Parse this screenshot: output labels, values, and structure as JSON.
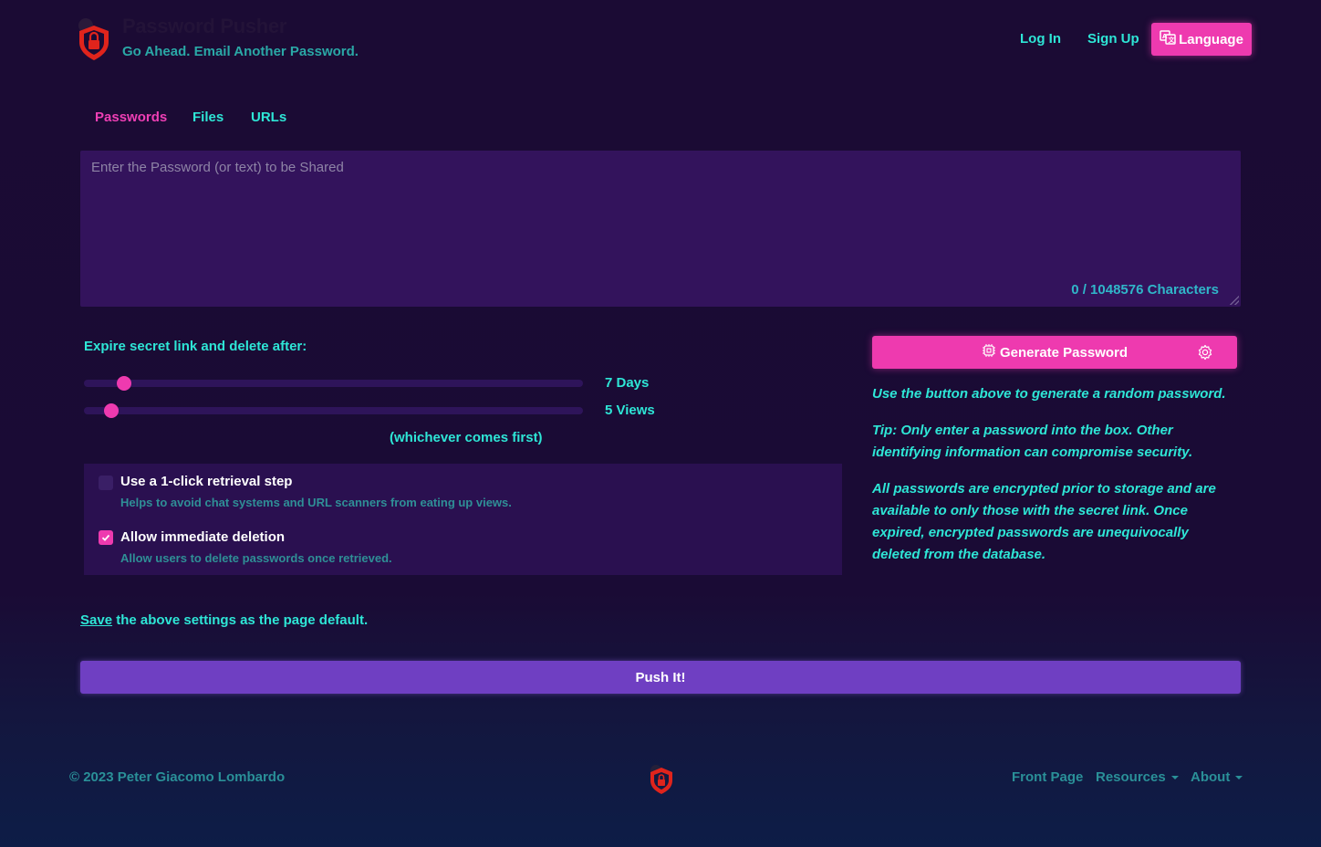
{
  "header": {
    "brand_title": "Password Pusher",
    "tagline": "Go Ahead. Email Another Password.",
    "login": "Log In",
    "signup": "Sign Up",
    "language": "Language",
    "logo_icon": "shield-lock-icon"
  },
  "tabs": [
    {
      "label": "Passwords",
      "active": true
    },
    {
      "label": "Files"
    },
    {
      "label": "URLs"
    }
  ],
  "editor": {
    "placeholder": "Enter the Password (or text) to be Shared",
    "value": "",
    "char_count": "0 / 1048576 Characters"
  },
  "expire": {
    "label": "Expire secret link and delete after:",
    "days_value": "7 Days",
    "views_value": "5 Views",
    "days_fraction": 0.08,
    "views_fraction": 0.054,
    "whichever": "(whichever comes first)"
  },
  "options": [
    {
      "title": "Use a 1-click retrieval step",
      "help": "Helps to avoid chat systems and URL scanners from eating up views.",
      "checked": false
    },
    {
      "title": "Allow immediate deletion",
      "help": "Allow users to delete passwords once retrieved.",
      "checked": true
    }
  ],
  "generator": {
    "button": "Generate Password",
    "info_1": "Use the button above to generate a random password.",
    "info_2": "Tip: Only enter a password into the box. Other identifying information can compromise security.",
    "info_3": "All passwords are encrypted prior to storage and are available to only those with the secret link. Once expired, encrypted passwords are unequivocally deleted from the database."
  },
  "save": {
    "link": "Save",
    "rest": " the above settings as the page default."
  },
  "push_button": "Push It!",
  "footer": {
    "copyright": "© 2023 Peter Giacomo Lombardo",
    "front_page": "Front Page",
    "resources": "Resources",
    "about": "About"
  },
  "colors": {
    "accent_pink": "#ee3aaf",
    "accent_teal": "#2ee6d6",
    "push_purple": "#6f3fc2",
    "background": "#1b0b34"
  }
}
